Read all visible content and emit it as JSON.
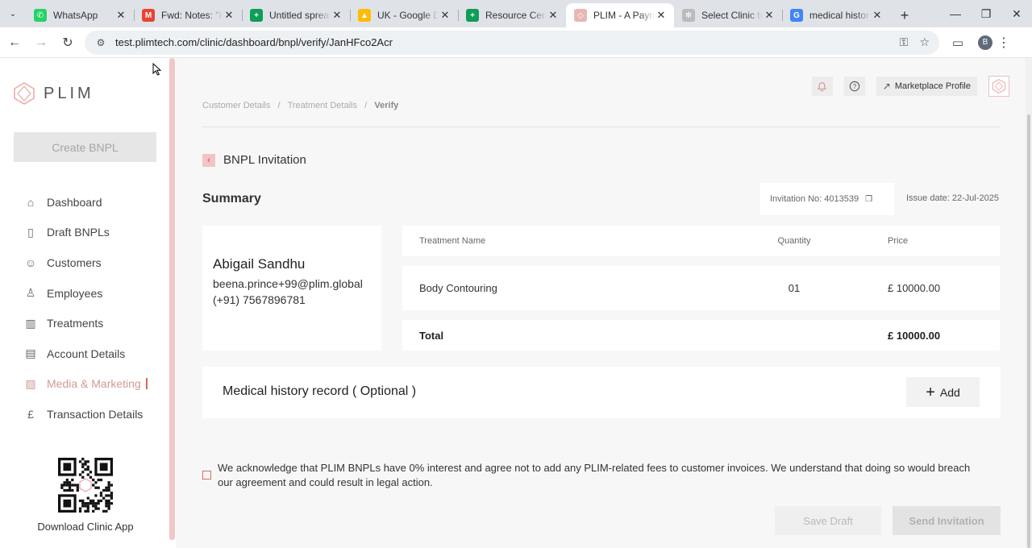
{
  "browser": {
    "tabs": [
      {
        "title": "WhatsApp",
        "icon": "whatsapp-icon",
        "color": "#25D366",
        "glyph": "✆"
      },
      {
        "title": "Fwd: Notes: \"Re",
        "icon": "gmail-icon",
        "color": "#EA4335",
        "glyph": "M"
      },
      {
        "title": "Untitled spreadsh",
        "icon": "sheets-icon",
        "color": "#0F9D58",
        "glyph": "+"
      },
      {
        "title": "UK - Google Driv",
        "icon": "drive-icon",
        "color": "#FBBC04",
        "glyph": "▲"
      },
      {
        "title": "Resource Centre",
        "icon": "sheets-icon",
        "color": "#0F9D58",
        "glyph": "+"
      },
      {
        "title": "PLIM - A Paymen",
        "icon": "plim-icon",
        "color": "#E9B7B2",
        "glyph": "◇",
        "active": true
      },
      {
        "title": "Select Clinic to c",
        "icon": "loading-icon",
        "color": "#BBBBBB",
        "glyph": "✻"
      },
      {
        "title": "medical history c",
        "icon": "google-icon",
        "color": "#4285F4",
        "glyph": "G"
      }
    ],
    "url": "test.plimtech.com/clinic/dashboard/bnpl/verify/JanHFco2Acr",
    "profile_initial": "B"
  },
  "sidebar": {
    "logo_text": "PLIM",
    "create_label": "Create BNPL",
    "items": [
      {
        "label": "Dashboard",
        "icon": "home-icon",
        "glyph": "⌂"
      },
      {
        "label": "Draft BNPLs",
        "icon": "file-icon",
        "glyph": "▯"
      },
      {
        "label": "Customers",
        "icon": "users-icon",
        "glyph": "☺"
      },
      {
        "label": "Employees",
        "icon": "user-add-icon",
        "glyph": "♙"
      },
      {
        "label": "Treatments",
        "icon": "treatments-icon",
        "glyph": "▥"
      },
      {
        "label": "Account Details",
        "icon": "id-card-icon",
        "glyph": "▤"
      },
      {
        "label": "Media & Marketing",
        "icon": "image-icon",
        "glyph": "▨",
        "active": true
      },
      {
        "label": "Transaction Details",
        "icon": "pound-icon",
        "glyph": "£"
      }
    ],
    "qr_label": "Download Clinic App"
  },
  "header": {
    "marketplace_label": "Marketplace Profile"
  },
  "breadcrumb": {
    "items": [
      "Customer Details",
      "Treatment Details",
      "Verify"
    ],
    "separator": "/"
  },
  "page": {
    "title": "BNPL Invitation",
    "summary_title": "Summary",
    "invitation_no": "Invitation No: 4013539",
    "issue_date": "Issue date: 22-Jul-2025"
  },
  "customer": {
    "name": "Abigail Sandhu",
    "email": "beena.prince+99@plim.global",
    "phone": "(+91) 7567896781"
  },
  "table": {
    "headers": {
      "name": "Treatment Name",
      "qty": "Quantity",
      "price": "Price"
    },
    "rows": [
      {
        "name": "Body Contouring",
        "qty": "01",
        "price": "£ 10000.00"
      }
    ],
    "total_label": "Total",
    "total_value": "£ 10000.00"
  },
  "medical": {
    "title": "Medical history record ( Optional )",
    "add_label": "Add"
  },
  "acknowledgement": "We acknowledge that PLIM BNPLs have 0% interest and agree not to add any PLIM-related fees to customer invoices. We understand that doing so would breach our agreement and could result in legal action.",
  "actions": {
    "save_draft": "Save Draft",
    "send_invitation": "Send Invitation"
  }
}
